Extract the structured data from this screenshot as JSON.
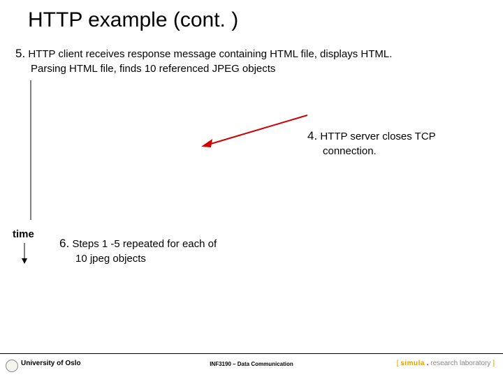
{
  "title": "HTTP example (cont. )",
  "step5": {
    "num": "5.",
    "line1": " HTTP client receives response message containing HTML file, displays HTML.",
    "line2": "Parsing HTML file, finds 10 referenced JPEG objects"
  },
  "step4": {
    "num": "4.",
    "line1": " HTTP server closes TCP",
    "line2": "connection."
  },
  "step6": {
    "num": "6.",
    "line1": " Steps 1 -5 repeated for each of",
    "line2": "10 jpeg objects"
  },
  "timeLabel": "time",
  "footer": {
    "left": "University of Oslo",
    "center": "INF3190 – Data Communication",
    "right": {
      "b1": "[ ",
      "sim": "simula",
      "dot": " . ",
      "rlab": "research laboratory",
      "b2": " ]"
    }
  }
}
